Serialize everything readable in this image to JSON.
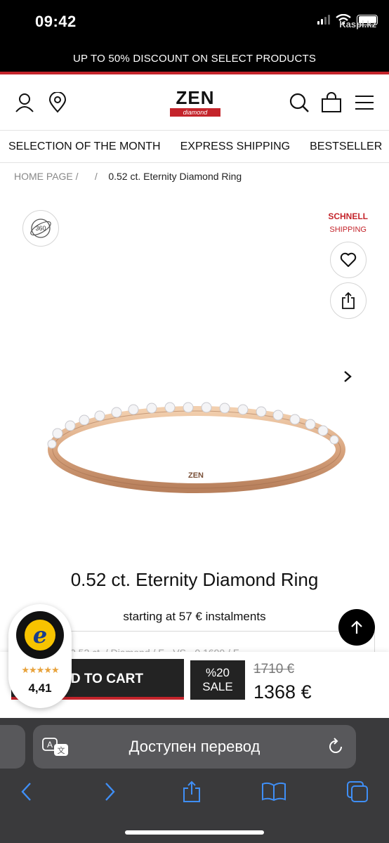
{
  "status_bar": {
    "time": "09:42",
    "watermark": "Kaspi.kz"
  },
  "promo": {
    "text": "UP TO 50% DISCOUNT ON SELECT PRODUCTS"
  },
  "header": {
    "logo_word": "ZEN",
    "logo_sub": "diamond"
  },
  "nav": {
    "items": [
      "SELECTION OF THE MONTH",
      "EXPRESS SHIPPING",
      "BESTSELLER"
    ]
  },
  "breadcrumb": {
    "home": "HOME PAGE",
    "sep1": "/",
    "sep2": "/",
    "current": "0.52 ct. Eternity Diamond Ring"
  },
  "gallery": {
    "view_360_label": "360",
    "badge_line1": "SCHNELL",
    "badge_line2": "SHIPPING"
  },
  "product": {
    "title": "0.52 ct. Eternity Diamond Ring",
    "installments": "starting at 57 € instalments",
    "variant_text": "0.52 ct. / Diamond / F - VS - 0.1690 / F"
  },
  "buy_bar": {
    "add_to_cart": "D TO CART",
    "sale_line1": "%20",
    "sale_line2": "SALE",
    "old_price": "1710 €",
    "new_price": "1368 €"
  },
  "trusted_shops": {
    "rating": "4,41",
    "rating_value": 4.41,
    "stars": "★★★★★"
  },
  "browser": {
    "url_bar_text": "Доступен перевод"
  },
  "colors": {
    "accent": "#c4242b",
    "dark": "#232323",
    "browser_bg": "#3a3a3c",
    "browser_link": "#3f8ff7"
  }
}
